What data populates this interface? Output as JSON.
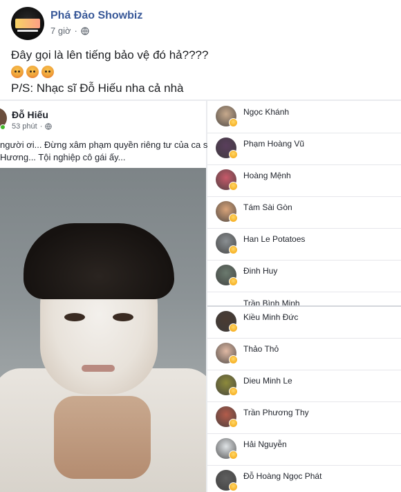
{
  "post": {
    "page_name": "Phá Đảo Showbiz",
    "time": "7 giờ",
    "separator": "·",
    "text_line1": "Đây gọi là lên tiếng bảo vệ đó hả????",
    "text_line3": "P/S: Nhạc sĩ Đỗ Hiếu nha cả nhà"
  },
  "embedded_post": {
    "author": "Đỗ Hiếu",
    "time": "53 phút",
    "separator": "·",
    "text_line1": "người ơi... Đừng xâm phạm quyền riêng tư của ca sĩ",
    "text_line2": "Hương... Tội nghiệp cô gái ấy..."
  },
  "reactions_top": [
    {
      "name": "Ngọc Khánh",
      "avatar_color": "#c7a98c"
    },
    {
      "name": "Phạm Hoàng Vũ",
      "avatar_color": "#5a3e5c"
    },
    {
      "name": "Hoàng Mệnh",
      "avatar_color": "#c85a6a"
    },
    {
      "name": "Tám Sài Gòn",
      "avatar_color": "#d9a47a"
    },
    {
      "name": "Han Le Potatoes",
      "avatar_color": "#8a8f92"
    },
    {
      "name": "Đinh Huy",
      "avatar_color": "#6b7a6e"
    }
  ],
  "reactions_cut": "Trần Bình Minh",
  "reactions_bottom": [
    {
      "name": "Kiều Minh Đức",
      "avatar_color": "#4a3b32"
    },
    {
      "name": "Thảo Thỏ",
      "avatar_color": "#e0b9a4"
    },
    {
      "name": "Dieu Minh Le",
      "avatar_color": "#8d8a3c"
    },
    {
      "name": "Trần Phương Thy",
      "avatar_color": "#b35c4b"
    },
    {
      "name": "Hải Nguyễn",
      "avatar_color": "#dfe3e6"
    },
    {
      "name": "Đỗ Hoàng Ngọc Phát",
      "avatar_color": "#5f5f5f"
    }
  ],
  "colors": {
    "page_name": "#385898",
    "meta": "#606770",
    "online": "#42b72a"
  },
  "icons": [
    "globe-icon",
    "angry-reaction-icon",
    "haha-reaction-icon"
  ]
}
